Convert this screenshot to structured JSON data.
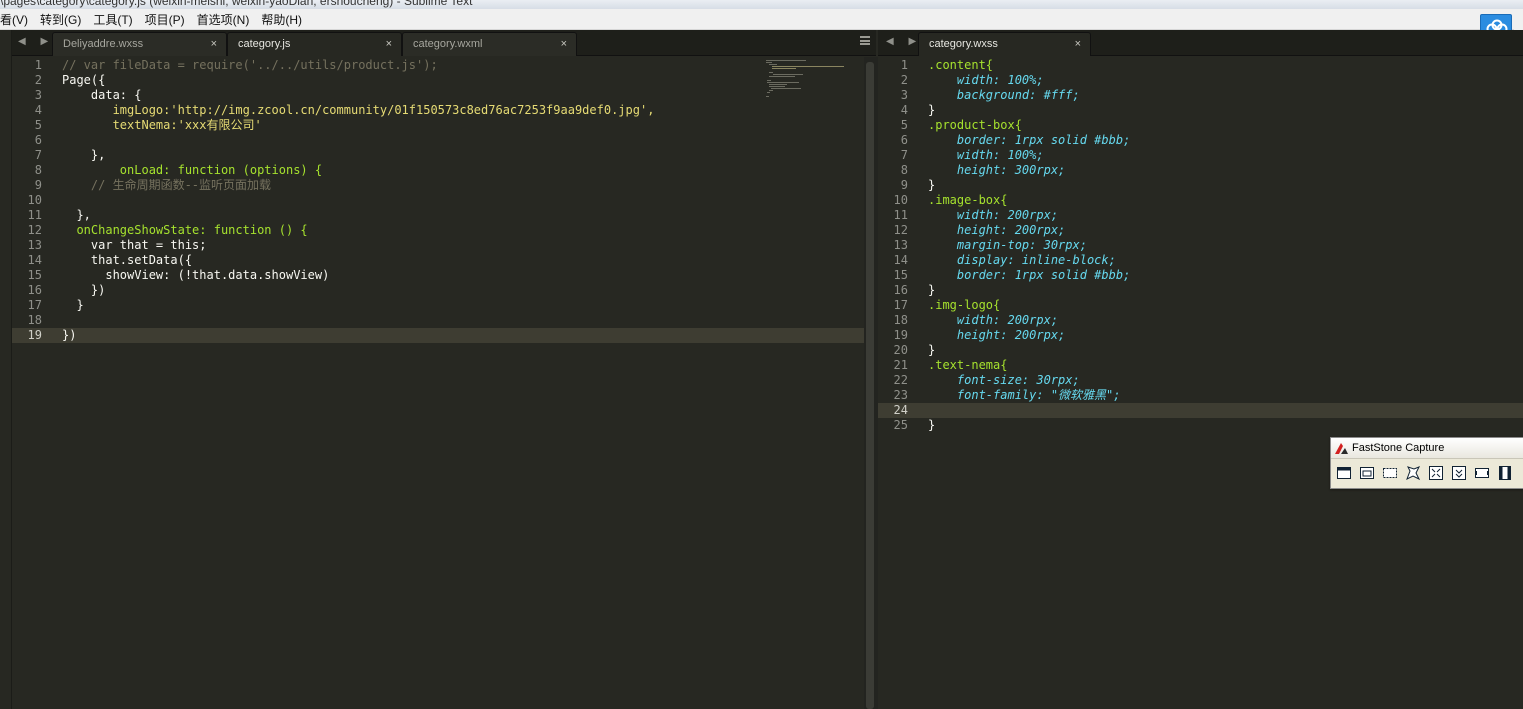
{
  "window": {
    "title": "\\pages\\category\\category.js (weixin-meishi, weixin-yaoDian, ershoucheng) - Sublime Text"
  },
  "menu": [
    "看(V)",
    "转到(G)",
    "工具(T)",
    "项目(P)",
    "首选项(N)",
    "帮助(H)"
  ],
  "left_tabs": [
    {
      "label": "Deliyaddre.wxss",
      "active": false
    },
    {
      "label": "category.js",
      "active": true
    },
    {
      "label": "category.wxml",
      "active": false
    }
  ],
  "right_tabs": [
    {
      "label": "category.wxss",
      "active": true
    }
  ],
  "close_glyph": "×",
  "nav_arrows": "◀ ▶",
  "left_editor": {
    "file": "category.js",
    "current_line": 19,
    "line_numbers": [
      "1",
      "2",
      "3",
      "4",
      "5",
      "6",
      "7",
      "8",
      "9",
      "10",
      "11",
      "12",
      "13",
      "14",
      "15",
      "16",
      "17",
      "18",
      "19"
    ],
    "lines": [
      "// var fileData = require('../../utils/product.js');",
      "Page({",
      "    data: {",
      "       imgLogo:'http://img.zcool.cn/community/01f150573c8ed76ac7253f9aa9def0.jpg',",
      "       textNema:'xxx有限公司'",
      "",
      "    },",
      "        onLoad: function (options) {",
      "    // 生命周期函数--监听页面加载",
      "",
      "  },",
      "  onChangeShowState: function () {",
      "    var that = this;",
      "    that.setData({",
      "      showView: (!that.data.showView)",
      "    })",
      "  }",
      "",
      "})"
    ]
  },
  "right_editor": {
    "file": "category.wxss",
    "current_line": 24,
    "line_numbers": [
      "1",
      "2",
      "3",
      "4",
      "5",
      "6",
      "7",
      "8",
      "9",
      "10",
      "11",
      "12",
      "13",
      "14",
      "15",
      "16",
      "17",
      "18",
      "19",
      "20",
      "21",
      "22",
      "23",
      "24",
      "25"
    ],
    "lines": [
      ".content{",
      "    width: 100%;",
      "    background: #fff;",
      "}",
      ".product-box{",
      "    border: 1rpx solid #bbb;",
      "    width: 100%;",
      "    height: 300rpx;",
      "}",
      ".image-box{",
      "    width: 200rpx;",
      "    height: 200rpx;",
      "    margin-top: 30rpx;",
      "    display: inline-block;",
      "    border: 1rpx solid #bbb;",
      "}",
      ".img-logo{",
      "    width: 200rpx;",
      "    height: 200rpx;",
      "}",
      ".text-nema{",
      "    font-size: 30rpx;",
      "    font-family: \"微软雅黑\";",
      "",
      "}"
    ]
  },
  "faststone": {
    "title": "FastStone Capture",
    "tools": [
      "capture-active-window-icon",
      "capture-window-object-icon",
      "capture-rectangular-region-icon",
      "capture-freehand-region-icon",
      "capture-full-screen-icon",
      "capture-scrolling-window-icon",
      "capture-fixed-region-icon",
      "screen-recorder-icon"
    ]
  },
  "colors": {
    "editor_bg": "#272822",
    "comment": "#75715e",
    "string": "#e6db74",
    "keyword": "#f92672",
    "function": "#a6e22e",
    "storage": "#66d9ef",
    "parameter": "#fd971f",
    "number": "#ae81ff"
  }
}
